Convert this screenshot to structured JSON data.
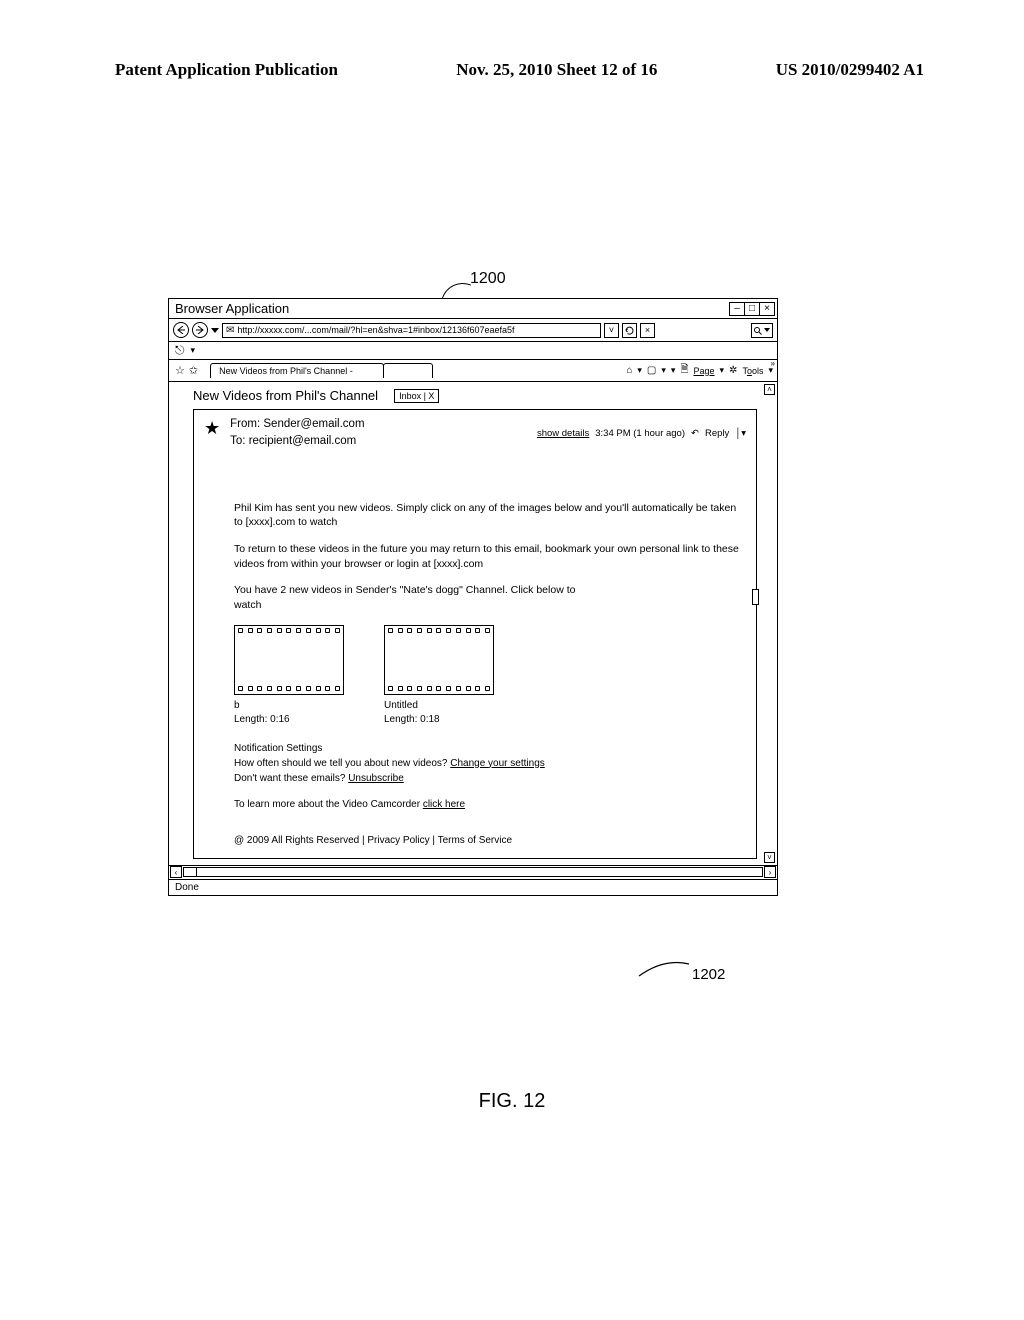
{
  "page_header": {
    "left": "Patent Application Publication",
    "mid": "Nov. 25, 2010  Sheet 12 of 16",
    "right": "US 2010/0299402 A1"
  },
  "callouts": {
    "c1200": "1200",
    "c1202": "1202"
  },
  "fig_label": "FIG. 12",
  "browser": {
    "title": "Browser Application",
    "win_min": "–",
    "win_max": "□",
    "win_close": "×",
    "url": "http://xxxxx.com/...com/mail/?hl=en&shva=1#inbox/12136f607eaefa5f",
    "tab_title": "New Videos from Phil's Channel -",
    "page_menu": "Page",
    "tools_menu": "Tools",
    "status": "Done"
  },
  "email": {
    "subject": "New Videos from Phil's Channel",
    "inbox_badge": "Inbox | X",
    "show_details": "show details",
    "time": "3:34 PM (1 hour ago)",
    "reply": "Reply",
    "from_label": "From:",
    "from_value": "Sender@email.com",
    "to_label": "To:",
    "to_value": "recipient@email.com",
    "para1": "Phil Kim has sent you new videos. Simply click on any of the images below and you'll automatically be taken to [xxxx].com to watch",
    "para2": "To return to these videos in the future you may return to this email, bookmark your own personal link to these videos from within your browser or login at [xxxx].com",
    "para3": "You have 2 new videos in Sender's \"Nate's dogg\" Channel. Click below to watch",
    "videos": [
      {
        "title": "b",
        "length_label": "Length:",
        "length": "0:16"
      },
      {
        "title": "Untitled",
        "length_label": "Length:",
        "length": "0:18"
      }
    ],
    "notif_heading": "Notification Settings",
    "notif_line1a": "How often should we tell you about new videos? ",
    "notif_line1b": "Change your settings",
    "notif_line2a": "Don't want these emails? ",
    "notif_line2b": "Unsubscribe",
    "learn_a": "To learn more about the Video Camcorder ",
    "learn_b": "click here",
    "footer": "@ 2009 All Rights Reserved | Privacy Policy | Terms of Service"
  }
}
